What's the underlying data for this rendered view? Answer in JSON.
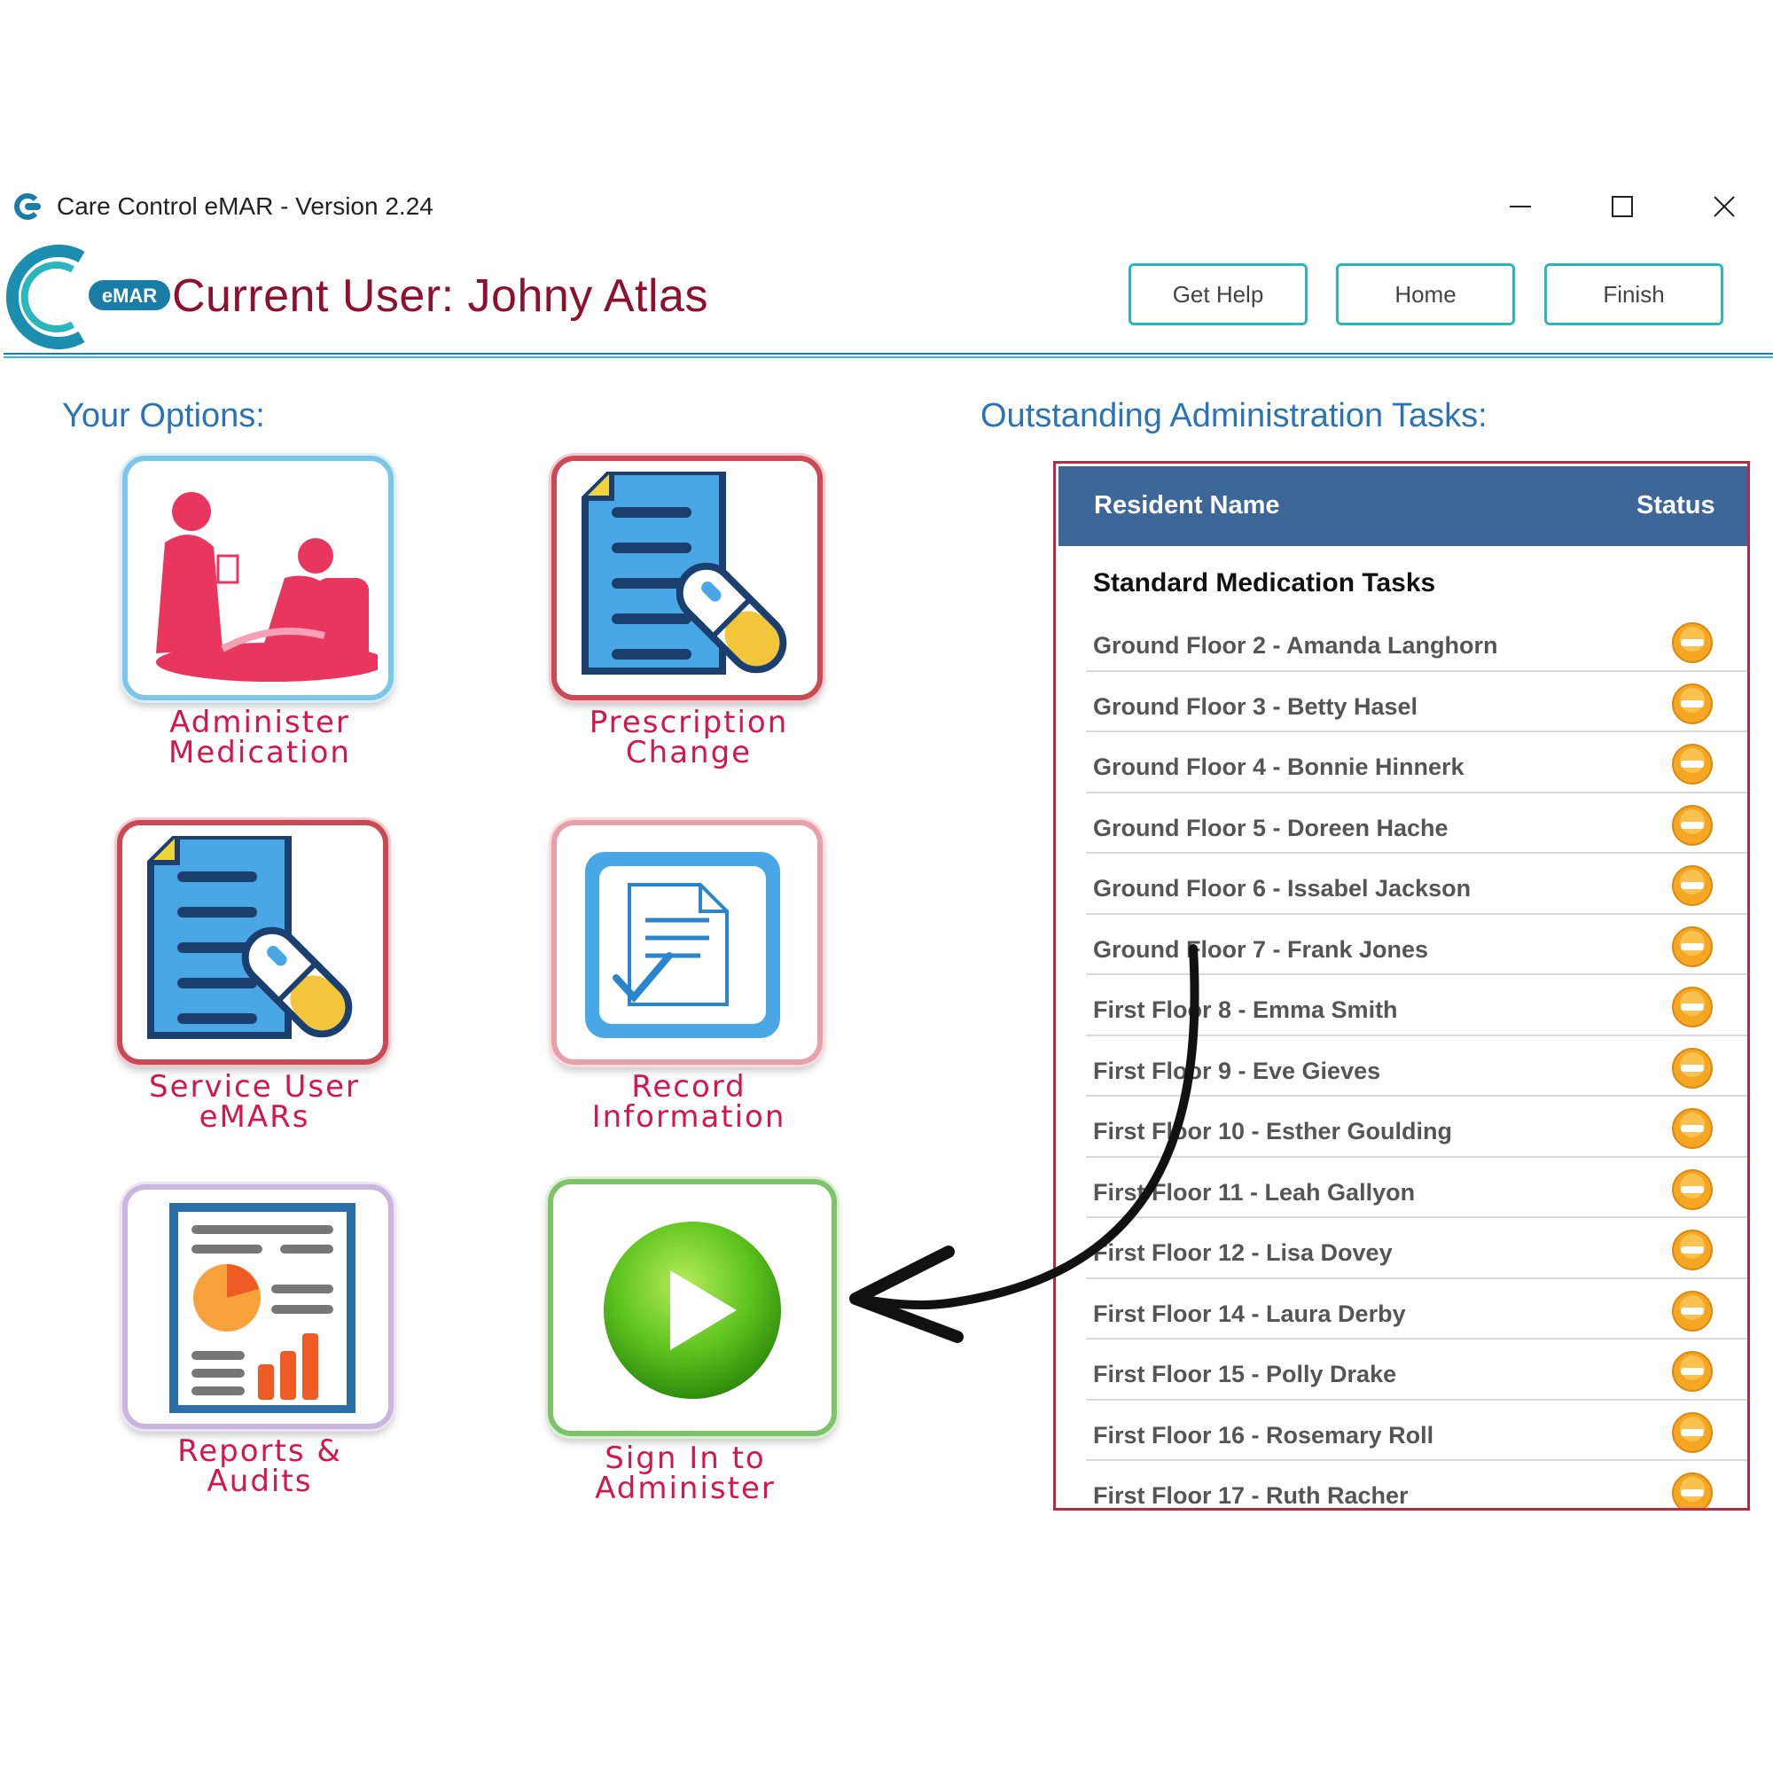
{
  "window": {
    "title": "Care Control eMAR - Version 2.24",
    "icon": "care-control-logo-icon"
  },
  "header": {
    "logo_badge": "eMAR",
    "current_user_label": "Current User: Johny Atlas",
    "buttons": {
      "help": "Get Help",
      "home": "Home",
      "finish": "Finish"
    },
    "accent_color": "#2bb5bc",
    "brand_color": "#8e1030"
  },
  "options": {
    "title": "Your Options:",
    "tiles": [
      {
        "label": "Administer\nMedication",
        "icon": "nurse-patient-icon"
      },
      {
        "label": "Prescription\nChange",
        "icon": "document-pill-icon"
      },
      {
        "label": "Service User\neMARs",
        "icon": "document-pill-icon"
      },
      {
        "label": "Record\nInformation",
        "icon": "document-check-icon"
      },
      {
        "label": "Reports &\nAudits",
        "icon": "report-chart-icon"
      },
      {
        "label": "Sign In to\nAdminister",
        "icon": "play-icon"
      }
    ]
  },
  "tasks": {
    "title": "Outstanding Administration Tasks:",
    "columns": {
      "name": "Resident Name",
      "status": "Status"
    },
    "group_title": "Standard Medication Tasks",
    "status_color": "#f5a623",
    "rows": [
      {
        "name": "Ground Floor 2 - Amanda Langhorn",
        "status": "outstanding-icon"
      },
      {
        "name": "Ground Floor 3 - Betty Hasel",
        "status": "outstanding-icon"
      },
      {
        "name": "Ground Floor 4 - Bonnie Hinnerk",
        "status": "outstanding-icon"
      },
      {
        "name": "Ground Floor 5 - Doreen Hache",
        "status": "outstanding-icon"
      },
      {
        "name": "Ground Floor 6 - Issabel Jackson",
        "status": "outstanding-icon"
      },
      {
        "name": "Ground Floor 7 - Frank Jones",
        "status": "outstanding-icon"
      },
      {
        "name": "First Floor 8 - Emma Smith",
        "status": "outstanding-icon"
      },
      {
        "name": "First Floor 9 - Eve Gieves",
        "status": "outstanding-icon"
      },
      {
        "name": "First Floor 10 - Esther Goulding",
        "status": "outstanding-icon"
      },
      {
        "name": "First Floor 11 - Leah Gallyon",
        "status": "outstanding-icon"
      },
      {
        "name": "First Floor 12 - Lisa Dovey",
        "status": "outstanding-icon"
      },
      {
        "name": "First Floor 14 - Laura Derby",
        "status": "outstanding-icon"
      },
      {
        "name": "First Floor 15 - Polly Drake",
        "status": "outstanding-icon"
      },
      {
        "name": "First Floor 16 - Rosemary Roll",
        "status": "outstanding-icon"
      },
      {
        "name": "First Floor 17 - Ruth Racher",
        "status": "outstanding-icon"
      }
    ]
  }
}
